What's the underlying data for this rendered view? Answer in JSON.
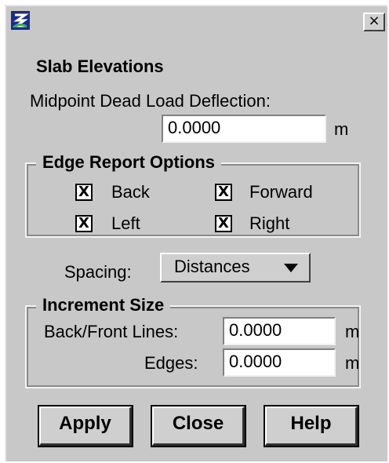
{
  "window": {
    "close_symbol": "×",
    "app_icon": "app-logo-icon"
  },
  "slab": {
    "heading": "Slab Elevations",
    "deflection_label": "Midpoint Dead Load Deflection:",
    "deflection_value": "0.0000",
    "deflection_unit": "m"
  },
  "edge_report": {
    "legend": "Edge Report Options",
    "options": [
      {
        "label": "Back",
        "checked": true
      },
      {
        "label": "Forward",
        "checked": true
      },
      {
        "label": "Left",
        "checked": true
      },
      {
        "label": "Right",
        "checked": true
      }
    ],
    "check_mark": "X"
  },
  "spacing": {
    "label": "Spacing:",
    "selected": "Distances"
  },
  "increment": {
    "legend": "Increment Size",
    "rows": [
      {
        "label": "Back/Front Lines:",
        "value": "0.0000",
        "unit": "m"
      },
      {
        "label": "Edges:",
        "value": "0.0000",
        "unit": "m"
      }
    ]
  },
  "buttons": {
    "apply": "Apply",
    "close": "Close",
    "help": "Help"
  }
}
